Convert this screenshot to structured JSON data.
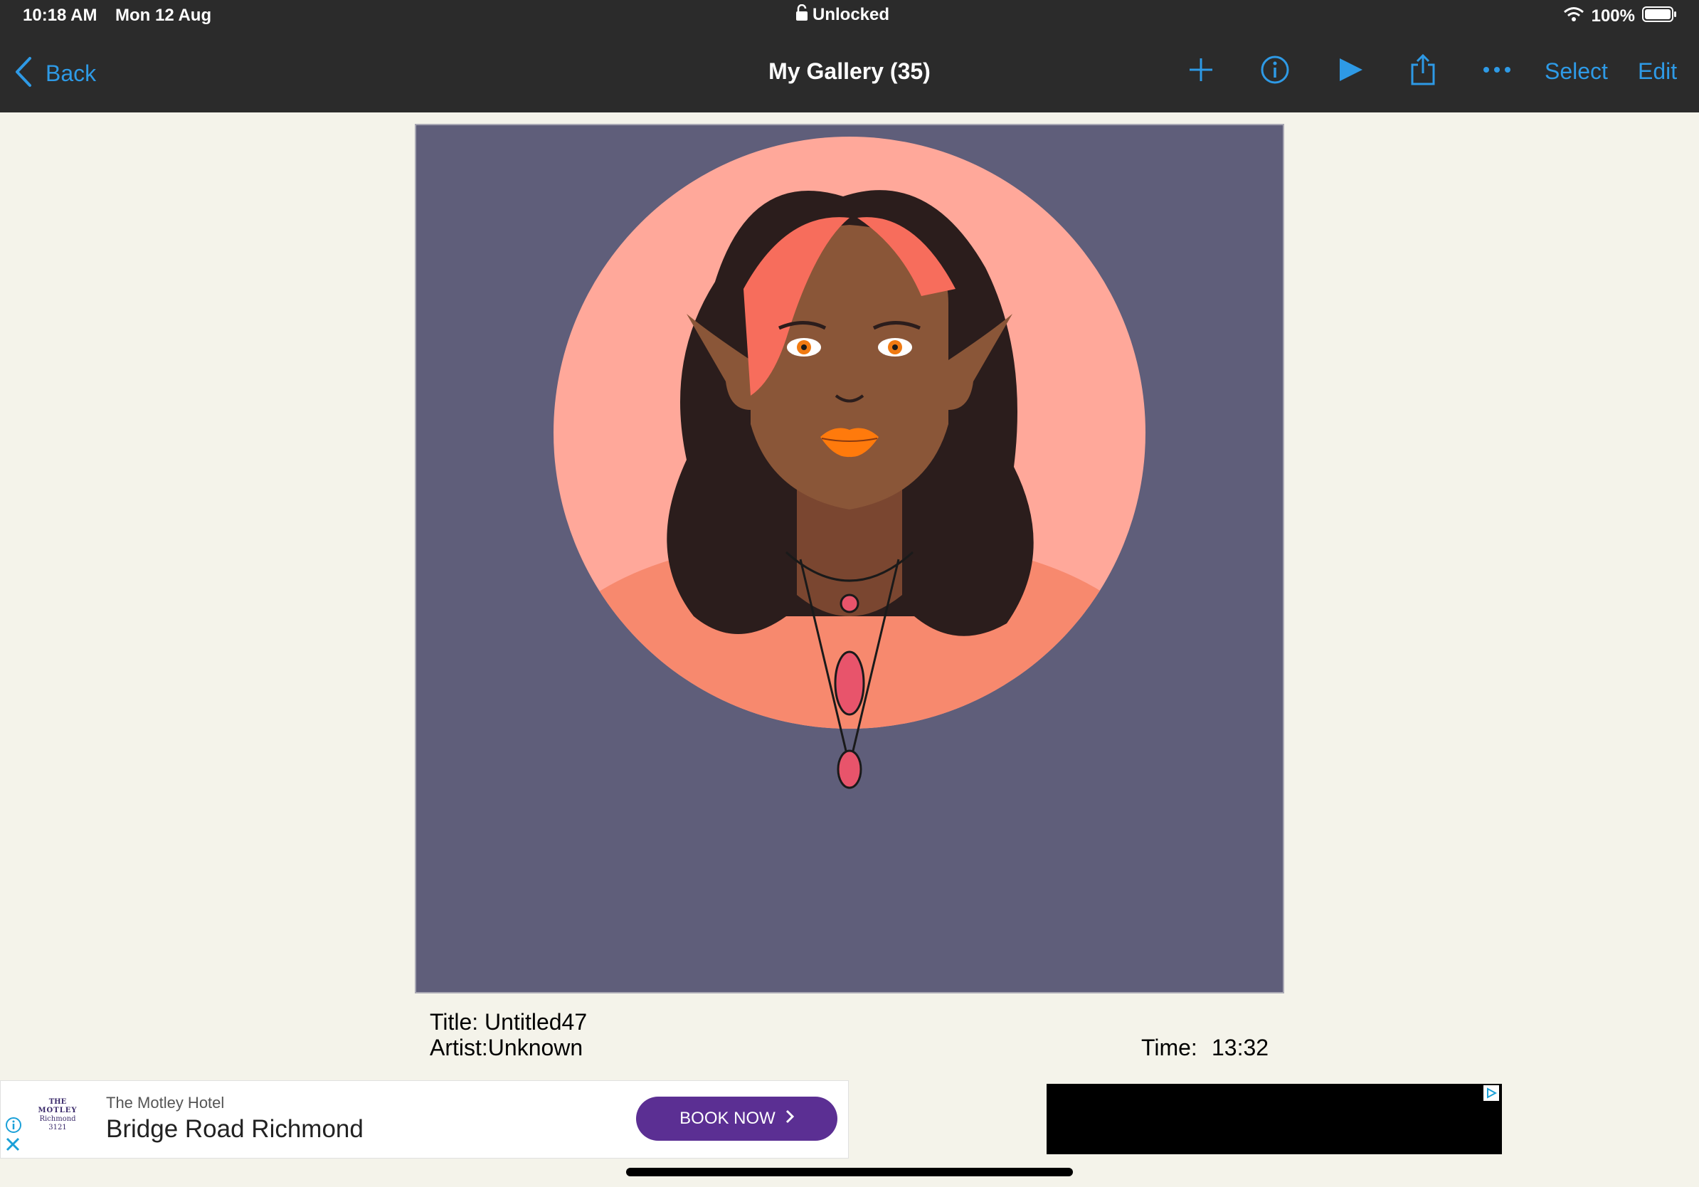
{
  "status_bar": {
    "time": "10:18 AM",
    "date": "Mon 12 Aug",
    "lock_text": "Unlocked",
    "battery": "100%"
  },
  "nav": {
    "back_label": "Back",
    "title": "My Gallery (35)",
    "select_label": "Select",
    "edit_label": "Edit",
    "icons": [
      "plus-icon",
      "info-icon",
      "play-icon",
      "share-icon",
      "more-icon"
    ],
    "accent_color": "#2e9ae6"
  },
  "artwork": {
    "background_color": "#5f5e7a",
    "circle_color": "#ffa89a"
  },
  "meta": {
    "title_line": "Title: Untitled47",
    "artist_line": "Artist:Unknown",
    "time_label": "Time:",
    "time_value": "13:32"
  },
  "ad": {
    "logo_lines": [
      "THE",
      "MOTLEY",
      "Richmond",
      "3121"
    ],
    "brand": "The Motley Hotel",
    "headline": "Bridge Road Richmond",
    "cta": "BOOK NOW",
    "cta_color": "#5b2f93"
  }
}
